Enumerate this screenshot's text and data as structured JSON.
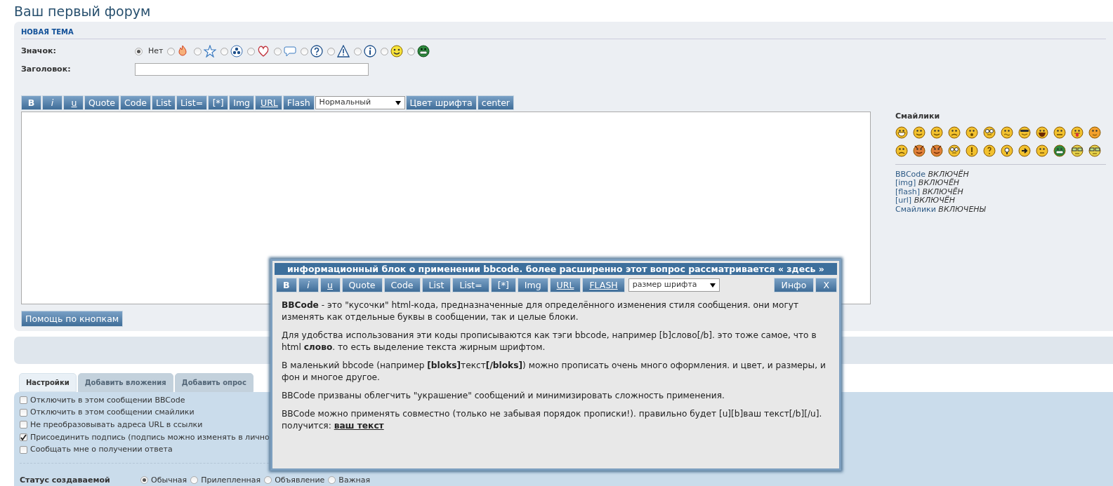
{
  "page_title": "Ваш первый форум",
  "new_topic": {
    "heading": "НОВАЯ ТЕМА",
    "icon_label": "Значок:",
    "subject_label": "Заголовок:",
    "icons": [
      {
        "kind": "none",
        "label": "Нет",
        "selected": true
      },
      {
        "kind": "flame",
        "selected": false
      },
      {
        "kind": "star",
        "selected": false
      },
      {
        "kind": "radiation",
        "selected": false
      },
      {
        "kind": "heart",
        "selected": false
      },
      {
        "kind": "speech",
        "selected": false
      },
      {
        "kind": "question",
        "selected": false
      },
      {
        "kind": "warning",
        "selected": false
      },
      {
        "kind": "info",
        "selected": false
      },
      {
        "kind": "smiley",
        "selected": false
      },
      {
        "kind": "grin",
        "selected": false
      }
    ]
  },
  "toolbar": {
    "buttons": [
      {
        "label": "B",
        "kind": "bold"
      },
      {
        "label": "i",
        "kind": "italic"
      },
      {
        "label": "u",
        "kind": "underline"
      },
      {
        "label": "Quote",
        "kind": "plain"
      },
      {
        "label": "Code",
        "kind": "plain"
      },
      {
        "label": "List",
        "kind": "plain"
      },
      {
        "label": "List=",
        "kind": "plain"
      },
      {
        "label": "[*]",
        "kind": "plain"
      },
      {
        "label": "Img",
        "kind": "plain"
      },
      {
        "label": "URL",
        "kind": "underline"
      },
      {
        "label": "Flash",
        "kind": "plain"
      }
    ],
    "size_select": "Нормальный",
    "buttons_after": [
      {
        "label": "Цвет шрифта"
      },
      {
        "label": "center"
      }
    ]
  },
  "smilies": {
    "title": "Смайлики",
    "items": [
      {
        "kind": "grin"
      },
      {
        "kind": "smile"
      },
      {
        "kind": "wink"
      },
      {
        "kind": "sad"
      },
      {
        "kind": "shocked"
      },
      {
        "kind": "eek"
      },
      {
        "kind": "confused"
      },
      {
        "kind": "cool"
      },
      {
        "kind": "laugh"
      },
      {
        "kind": "mad"
      },
      {
        "kind": "razz"
      },
      {
        "kind": "blush"
      },
      {
        "kind": "sad"
      },
      {
        "kind": "evil"
      },
      {
        "kind": "evil"
      },
      {
        "kind": "eek"
      },
      {
        "kind": "exclaim"
      },
      {
        "kind": "question"
      },
      {
        "kind": "idea"
      },
      {
        "kind": "arrow"
      },
      {
        "kind": "neutral"
      },
      {
        "kind": "green"
      },
      {
        "kind": "geek"
      },
      {
        "kind": "geek"
      }
    ]
  },
  "bbcode_status": [
    {
      "name": "BBCode",
      "value": "ВКЛЮЧЁН"
    },
    {
      "name": "[img]",
      "value": "ВКЛЮЧЁН"
    },
    {
      "name": "[flash]",
      "value": "ВКЛЮЧЁН"
    },
    {
      "name": "[url]",
      "value": "ВКЛЮЧЁН"
    },
    {
      "name": "Смайлики",
      "value": "ВКЛЮЧЕНЫ"
    }
  ],
  "help_button": "Помощь по кнопкам",
  "tabs": [
    {
      "label": "Настройки",
      "selected": true
    },
    {
      "label": "Добавить вложения",
      "selected": false
    },
    {
      "label": "Добавить опрос",
      "selected": false
    }
  ],
  "options": [
    {
      "label": "Отключить в этом сообщении BBCode",
      "checked": false
    },
    {
      "label": "Отключить в этом сообщении смайлики",
      "checked": false
    },
    {
      "label": "Не преобразовывать адреса URL в ссылки",
      "checked": false
    },
    {
      "label": "Присоединить подпись (подпись можно изменять в лично",
      "checked": true
    },
    {
      "label": "Сообщать мне о получении ответа",
      "checked": false
    }
  ],
  "topic_status": {
    "label": "Статус создаваемой",
    "options": [
      {
        "label": "Обычная",
        "selected": true
      },
      {
        "label": "Прилепленная",
        "selected": false
      },
      {
        "label": "Объявление",
        "selected": false
      },
      {
        "label": "Важная",
        "selected": false
      }
    ]
  },
  "popup": {
    "title": "информационный блок о применении bbcode. более расширенно этот вопрос рассматривается",
    "title_link": "« здесь »",
    "buttons": [
      {
        "label": "B",
        "kind": "bold"
      },
      {
        "label": "i",
        "kind": "italic"
      },
      {
        "label": "u",
        "kind": "underline"
      },
      {
        "label": "Quote",
        "kind": "plain"
      },
      {
        "label": "Code",
        "kind": "plain"
      },
      {
        "label": "List",
        "kind": "plain"
      },
      {
        "label": "List=",
        "kind": "plain"
      },
      {
        "label": "[*]",
        "kind": "plain"
      },
      {
        "label": "Img",
        "kind": "plain"
      },
      {
        "label": "URL",
        "kind": "underline"
      },
      {
        "label": "FLASH",
        "kind": "underline"
      }
    ],
    "size_select": "размер шрифта",
    "right_buttons": [
      {
        "label": "Инфо"
      },
      {
        "label": "X"
      }
    ],
    "paragraphs": [
      {
        "text": "**BBCode** - это \"кусочки\" html-кода, предназначенные для определённого изменения стиля сообщения. они могут изменять как отдельные буквы в сообщении, так и целые блоки."
      },
      {
        "text": "Для удобства использования эти коды прописываются как тэги bbcode, например [b]слово[/b]. это тоже самое, что в html **слово**. то есть выделение текста жирным шрифтом."
      },
      {
        "text": "В маленький bbcode (например **[bloks]**текст**[/bloks]**) можно прописать очень много оформления. и цвет, и размеры, и фон и многое другое."
      },
      {
        "text": "BBCode призваны облегчить \"украшение\" сообщений и минимизировать сложность применения."
      },
      {
        "text": "BBCode можно применять совместно (только не забывая порядок прописки!). правильно будет [u][b]ваш текст[/b][/u]. получится:",
        "result": "ваш текст"
      }
    ]
  }
}
